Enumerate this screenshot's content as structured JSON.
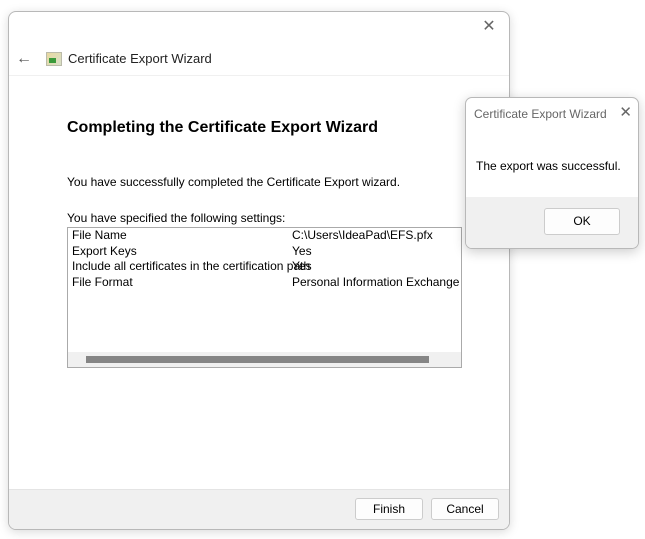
{
  "wizard": {
    "title": "Certificate Export Wizard",
    "heading": "Completing the Certificate Export Wizard",
    "intro": "You have successfully completed the Certificate Export wizard.",
    "settings_label": "You have specified the following settings:",
    "settings": [
      {
        "key": "File Name",
        "value": "C:\\Users\\IdeaPad\\EFS.pfx"
      },
      {
        "key": "Export Keys",
        "value": "Yes"
      },
      {
        "key": "Include all certificates in the certification path",
        "value": "Yes"
      },
      {
        "key": "File Format",
        "value": "Personal Information Exchange (*.p"
      }
    ],
    "finish": "Finish",
    "cancel": "Cancel",
    "close": "✕",
    "back": "←"
  },
  "dialog": {
    "title": "Certificate Export Wizard",
    "message": "The export was successful.",
    "ok": "OK",
    "close": "✕"
  }
}
